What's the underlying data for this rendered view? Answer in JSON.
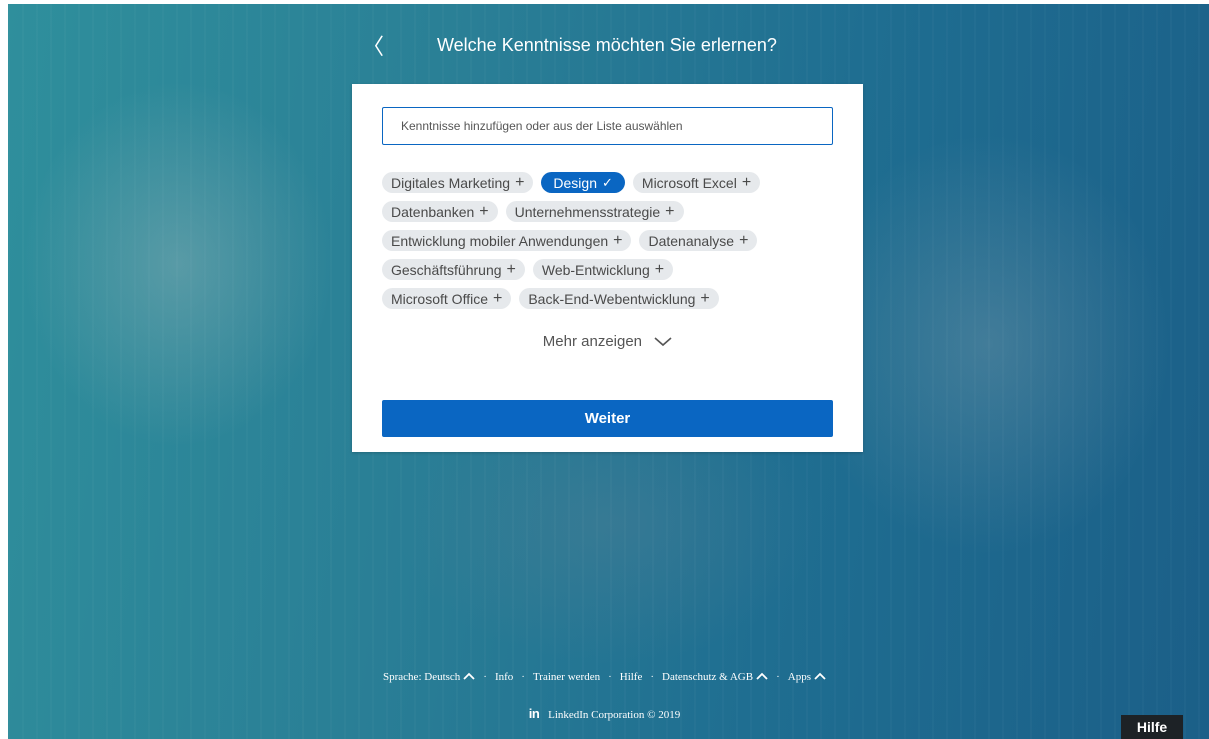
{
  "header": {
    "back_glyph": "〈",
    "title": "Welche Kenntnisse möchten Sie erlernen?"
  },
  "search": {
    "placeholder": "Kenntnisse hinzufügen oder aus der Liste auswählen"
  },
  "skills": [
    [
      {
        "label": "Digitales Marketing",
        "selected": false
      },
      {
        "label": "Design",
        "selected": true
      },
      {
        "label": "Microsoft Excel",
        "selected": false
      }
    ],
    [
      {
        "label": "Datenbanken",
        "selected": false
      },
      {
        "label": "Unternehmensstrategie",
        "selected": false
      }
    ],
    [
      {
        "label": "Entwicklung mobiler Anwendungen",
        "selected": false
      },
      {
        "label": "Datenanalyse",
        "selected": false
      }
    ],
    [
      {
        "label": "Geschäftsführung",
        "selected": false
      },
      {
        "label": "Web-Entwicklung",
        "selected": false
      }
    ],
    [
      {
        "label": "Microsoft Office",
        "selected": false
      },
      {
        "label": "Back-End-Webentwicklung",
        "selected": false
      }
    ]
  ],
  "symbols": {
    "add": "+",
    "selected": "✓"
  },
  "more_label": "Mehr anzeigen",
  "continue_label": "Weiter",
  "footer": {
    "links": [
      {
        "label": "Sprache: Deutsch",
        "dropdown": true
      },
      {
        "label": "Info",
        "dropdown": false
      },
      {
        "label": "Trainer werden",
        "dropdown": false
      },
      {
        "label": "Hilfe",
        "dropdown": false
      },
      {
        "label": "Datenschutz & AGB",
        "dropdown": true
      },
      {
        "label": "Apps",
        "dropdown": true
      }
    ],
    "separator": "·",
    "logo": "in",
    "copyright": "LinkedIn Corporation © 2019"
  },
  "help_button": "Hilfe",
  "colors": {
    "accent": "#0a66c2",
    "chip_bg": "#e6e9ec",
    "help_bg": "#1d2226"
  }
}
